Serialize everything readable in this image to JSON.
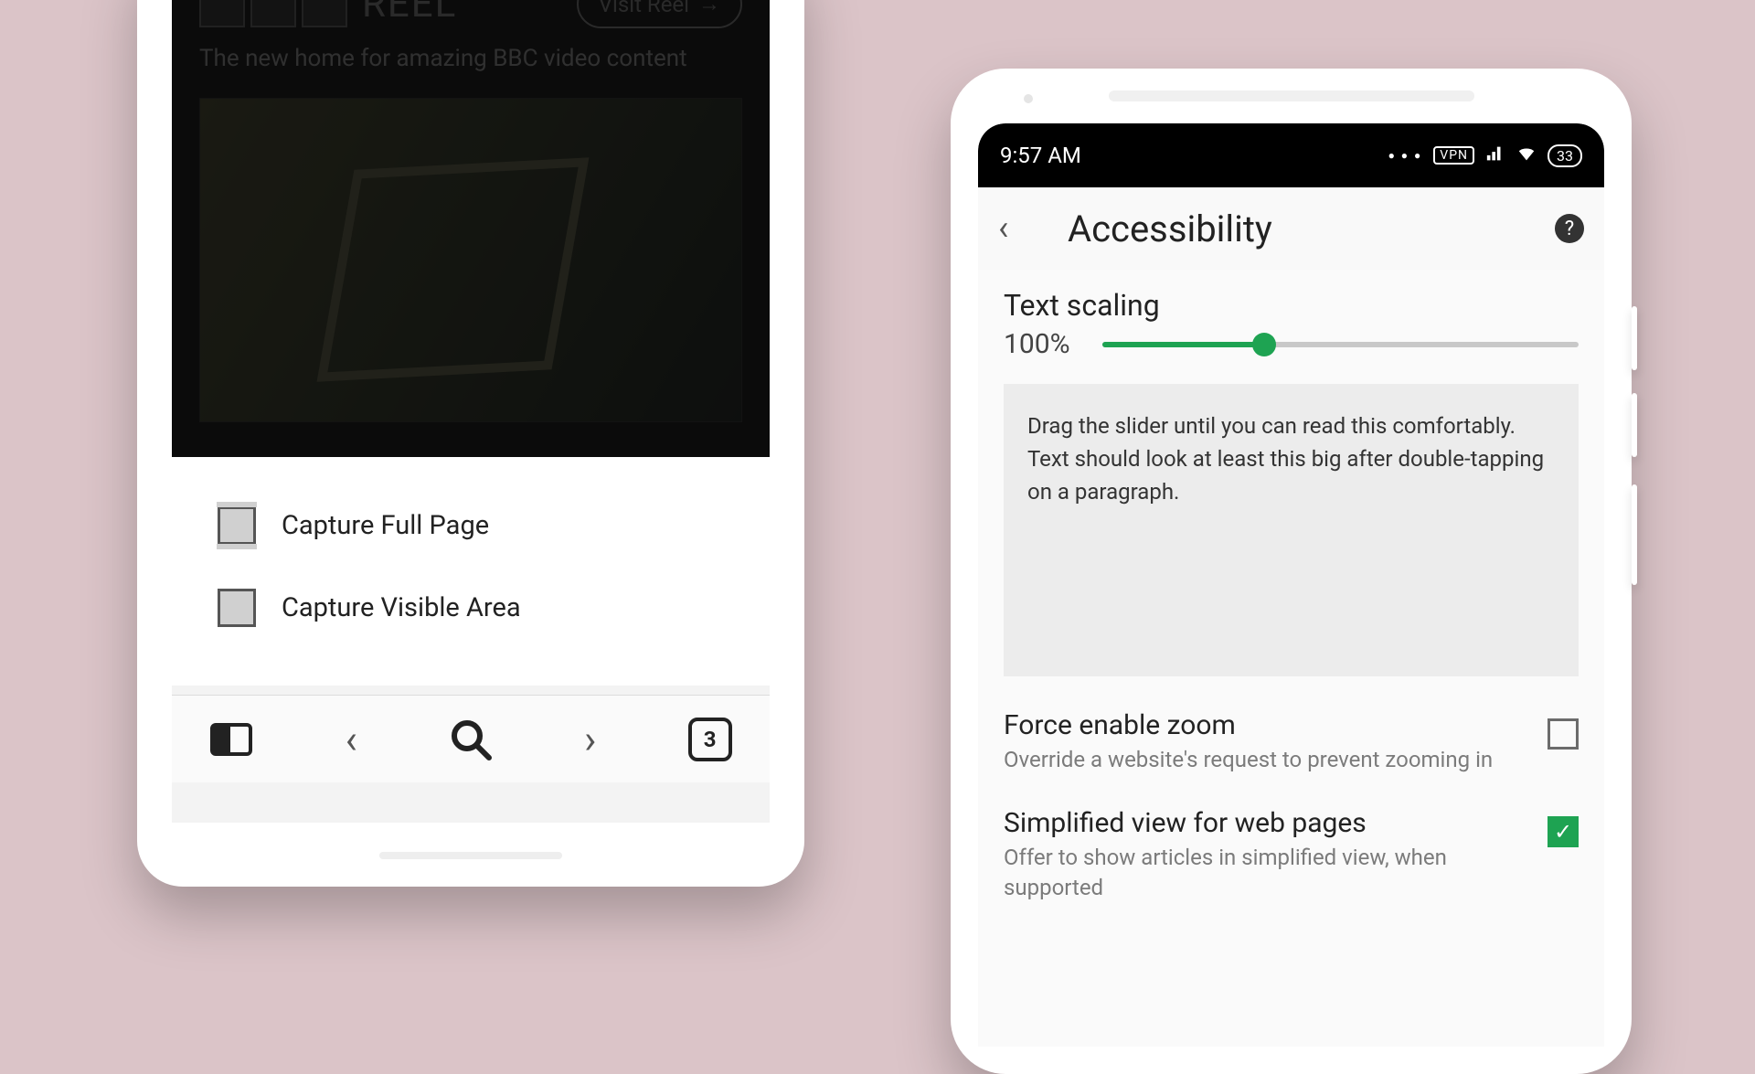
{
  "left": {
    "reel": {
      "logo_word": "REEL",
      "visit_label": "Visit Reel",
      "subtitle": "The new home for amazing BBC video content"
    },
    "menu": {
      "capture_full": "Capture Full Page",
      "capture_visible": "Capture Visible Area"
    },
    "nav": {
      "tab_count": "3"
    }
  },
  "right": {
    "status": {
      "time": "9:57 AM",
      "vpn": "VPN",
      "battery": "33"
    },
    "appbar": {
      "title": "Accessibility"
    },
    "text_scaling": {
      "title": "Text scaling",
      "value": "100%",
      "preview": "Drag the slider until you can read this comfortably. Text should look at least this big after double-tapping on a paragraph."
    },
    "force_zoom": {
      "title": "Force enable zoom",
      "desc": "Override a website's request to prevent zooming in"
    },
    "simplified": {
      "title": "Simplified view for web pages",
      "desc": "Offer to show articles in simplified view, when supported"
    }
  }
}
